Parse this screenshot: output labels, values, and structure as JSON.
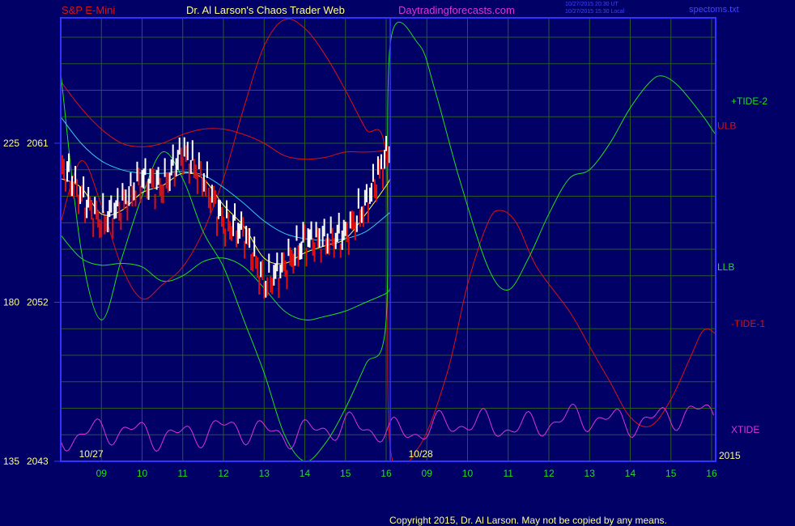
{
  "header": {
    "symbol": "S&P E-Mini",
    "title": "Dr. Al Larson's Chaos Trader Web",
    "site": "Daytradingforecasts.com",
    "timestamp_utc": "10/27/2015 20:30 UT",
    "timestamp_local": "10/27/2015 15:30 Local",
    "file": "spectoms.txt"
  },
  "copyright": "Copyright 2015, Dr. Al Larson. May not be copied by any means.",
  "colors": {
    "background": "#000066",
    "axis": "#3333ff",
    "grid": "#2a5a2a",
    "red": "#dd1111",
    "green": "#22dd22",
    "magenta": "#dd33dd",
    "yellow": "#ffff44",
    "cyan": "#33ccee",
    "white": "#ffffff",
    "label": "#ffff88"
  },
  "chart_data": {
    "type": "line",
    "title": "S&P E-Mini",
    "x_tick_labels": [
      "09",
      "10",
      "11",
      "12",
      "13",
      "14",
      "15",
      "16",
      "09",
      "10",
      "11",
      "12",
      "13",
      "14",
      "15",
      "16"
    ],
    "date_labels": [
      "10/27",
      "10/28"
    ],
    "year_label": "2015",
    "ylabels": [
      {
        "left": "225",
        "price": "2061"
      },
      {
        "left": "180",
        "price": "2052"
      },
      {
        "left": "135",
        "price": "2043"
      }
    ],
    "ylim": [
      2043,
      2068.1
    ],
    "xlim": [
      8,
      24.1
    ],
    "now_x": 16.1,
    "grid": true,
    "legend": [
      {
        "name": "+TIDE-2",
        "color": "#22dd22"
      },
      {
        "name": "ULB",
        "color": "#dd1111"
      },
      {
        "name": "LLB",
        "color": "#22dd22"
      },
      {
        "name": "-TIDE-1",
        "color": "#dd1111"
      },
      {
        "name": "XTIDE",
        "color": "#dd33dd"
      }
    ],
    "series": [
      {
        "name": "ULB",
        "color": "#dd1111",
        "points": [
          [
            8,
            2064.5
          ],
          [
            8.5,
            2063
          ],
          [
            9,
            2061.8
          ],
          [
            9.5,
            2061
          ],
          [
            10,
            2060.8
          ],
          [
            10.5,
            2061
          ],
          [
            11,
            2061.5
          ],
          [
            11.5,
            2061.8
          ],
          [
            12,
            2061.8
          ],
          [
            12.5,
            2061.5
          ],
          [
            13,
            2061
          ],
          [
            13.5,
            2060.3
          ],
          [
            14,
            2060.1
          ],
          [
            14.5,
            2060.2
          ],
          [
            15,
            2060.5
          ],
          [
            15.5,
            2060.5
          ],
          [
            16,
            2060.6
          ],
          [
            16.1,
            2060.7
          ]
        ]
      },
      {
        "name": "LLB",
        "color": "#22dd22",
        "points": [
          [
            8,
            2055.8
          ],
          [
            8.5,
            2054.5
          ],
          [
            9,
            2054.1
          ],
          [
            9.5,
            2054.2
          ],
          [
            10,
            2054
          ],
          [
            10.5,
            2053.2
          ],
          [
            11,
            2053.5
          ],
          [
            11.5,
            2054.3
          ],
          [
            12,
            2054.5
          ],
          [
            12.5,
            2054
          ],
          [
            13,
            2052.8
          ],
          [
            13.5,
            2051.5
          ],
          [
            14,
            2051
          ],
          [
            14.5,
            2051.2
          ],
          [
            15,
            2051.5
          ],
          [
            15.5,
            2052
          ],
          [
            16,
            2052.5
          ],
          [
            16.1,
            2052.8
          ]
        ]
      },
      {
        "name": "-TIDE-1",
        "color": "#dd1111",
        "points": [
          [
            8,
            2056.5
          ],
          [
            8.5,
            2060
          ],
          [
            9,
            2057.5
          ],
          [
            9.5,
            2054
          ],
          [
            10,
            2052.2
          ],
          [
            10.5,
            2053
          ],
          [
            11,
            2054
          ],
          [
            11.5,
            2056
          ],
          [
            12,
            2059
          ],
          [
            12.5,
            2063
          ],
          [
            13,
            2066.5
          ],
          [
            13.5,
            2068
          ],
          [
            14,
            2067.5
          ],
          [
            14.5,
            2066
          ],
          [
            15,
            2064
          ],
          [
            15.5,
            2061.8
          ],
          [
            16,
            2060
          ],
          [
            16.1,
            2043.8
          ],
          [
            16.8,
            2043.8
          ],
          [
            17.5,
            2048
          ],
          [
            18,
            2053
          ],
          [
            18.5,
            2056.5
          ],
          [
            18.8,
            2057.2
          ],
          [
            19.2,
            2056.5
          ],
          [
            19.7,
            2054
          ],
          [
            20.5,
            2051.5
          ],
          [
            21,
            2049.5
          ],
          [
            21.5,
            2047.5
          ],
          [
            22,
            2045.5
          ],
          [
            22.5,
            2045
          ],
          [
            23,
            2046.5
          ],
          [
            23.5,
            2049
          ],
          [
            23.8,
            2050.4
          ],
          [
            24.1,
            2050.2
          ],
          [
            24.5,
            2049
          ],
          [
            25,
            2048
          ],
          [
            25.3,
            2047.5
          ]
        ]
      },
      {
        "name": "+TIDE-2",
        "color": "#22dd22",
        "points": [
          [
            8,
            2065
          ],
          [
            8.5,
            2055
          ],
          [
            9,
            2051
          ],
          [
            9.5,
            2054.5
          ],
          [
            10,
            2058
          ],
          [
            10.5,
            2060.5
          ],
          [
            11,
            2059
          ],
          [
            11.5,
            2056
          ],
          [
            12,
            2054
          ],
          [
            12.5,
            2051
          ],
          [
            13,
            2048
          ],
          [
            13.5,
            2044.5
          ],
          [
            14,
            2043
          ],
          [
            14.5,
            2044
          ],
          [
            15,
            2046
          ],
          [
            15.5,
            2048.5
          ],
          [
            16,
            2051
          ],
          [
            16.1,
            2066.6
          ],
          [
            16.8,
            2066.6
          ],
          [
            17.2,
            2064
          ],
          [
            17.8,
            2059
          ],
          [
            18.5,
            2054
          ],
          [
            19,
            2052.7
          ],
          [
            19.5,
            2054.5
          ],
          [
            20,
            2057
          ],
          [
            20.5,
            2059
          ],
          [
            21,
            2059.5
          ],
          [
            21.5,
            2061
          ],
          [
            22,
            2063
          ],
          [
            22.5,
            2064.5
          ],
          [
            22.8,
            2064.8
          ],
          [
            23.2,
            2064.2
          ],
          [
            23.8,
            2062.5
          ],
          [
            24.2,
            2061.2
          ],
          [
            24.5,
            2060.9
          ],
          [
            25,
            2061
          ],
          [
            25.5,
            2061.5
          ],
          [
            26,
            2062.3
          ]
        ]
      },
      {
        "name": "XTIDE",
        "color": "#dd33dd",
        "wave": true,
        "points": [
          [
            8,
            2044.5
          ],
          [
            16.1,
            2044.8
          ],
          [
            24.1,
            2045.6
          ]
        ]
      },
      {
        "name": "Price",
        "color": "#ffffff",
        "points": [
          [
            8,
            2059.8
          ],
          [
            8.5,
            2058
          ],
          [
            9,
            2056.5
          ],
          [
            9.5,
            2057.5
          ],
          [
            10,
            2059
          ],
          [
            10.5,
            2058.5
          ],
          [
            11,
            2060.5
          ],
          [
            11.5,
            2059
          ],
          [
            12,
            2056.5
          ],
          [
            12.5,
            2056
          ],
          [
            13,
            2053
          ],
          [
            13.5,
            2054
          ],
          [
            14,
            2055.5
          ],
          [
            14.5,
            2055.5
          ],
          [
            15,
            2055.8
          ],
          [
            15.5,
            2057.5
          ],
          [
            16,
            2060.3
          ],
          [
            16.1,
            2060.5
          ]
        ]
      },
      {
        "name": "MA fast",
        "color": "#ffff44",
        "points": [
          [
            8,
            2059
          ],
          [
            8.5,
            2058.5
          ],
          [
            9,
            2057
          ],
          [
            9.5,
            2057.2
          ],
          [
            10,
            2058.2
          ],
          [
            10.5,
            2058.6
          ],
          [
            11,
            2059.3
          ],
          [
            11.5,
            2059
          ],
          [
            12,
            2057.5
          ],
          [
            12.5,
            2056.3
          ],
          [
            13,
            2054.5
          ],
          [
            13.5,
            2054.2
          ],
          [
            14,
            2054.8
          ],
          [
            14.5,
            2055.2
          ],
          [
            15,
            2055.6
          ],
          [
            15.5,
            2057
          ],
          [
            16,
            2058.6
          ],
          [
            16.1,
            2059
          ]
        ]
      },
      {
        "name": "MA slow",
        "color": "#33ccee",
        "points": [
          [
            8,
            2062.5
          ],
          [
            8.5,
            2061
          ],
          [
            9,
            2060
          ],
          [
            9.5,
            2059.5
          ],
          [
            10,
            2059.3
          ],
          [
            10.5,
            2059.3
          ],
          [
            11,
            2059.4
          ],
          [
            11.5,
            2059.2
          ],
          [
            12,
            2058.5
          ],
          [
            12.5,
            2057.6
          ],
          [
            13,
            2056.6
          ],
          [
            13.5,
            2055.9
          ],
          [
            14,
            2055.6
          ],
          [
            14.5,
            2055.5
          ],
          [
            15,
            2055.6
          ],
          [
            15.5,
            2056
          ],
          [
            16,
            2056.9
          ],
          [
            16.1,
            2057.1
          ]
        ]
      }
    ]
  }
}
